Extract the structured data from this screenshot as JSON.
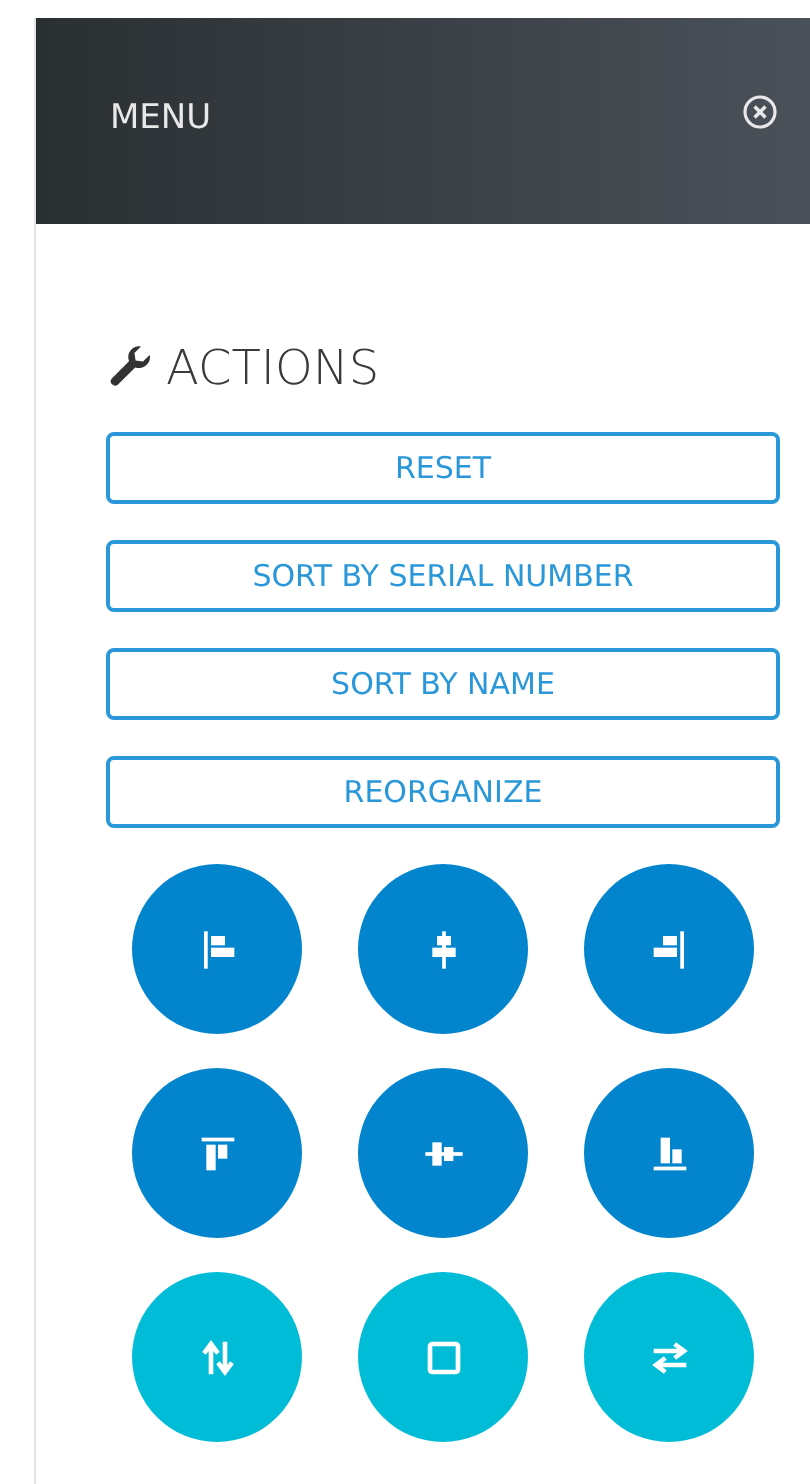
{
  "menu": {
    "title": "MENU"
  },
  "actions": {
    "heading": "ACTIONS",
    "buttons": [
      {
        "label": "RESET"
      },
      {
        "label": "SORT BY SERIAL NUMBER"
      },
      {
        "label": "SORT BY NAME"
      },
      {
        "label": "REORGANIZE"
      }
    ]
  },
  "tool_buttons": [
    {
      "color": "#0385cd"
    },
    {
      "color": "#0385cd"
    },
    {
      "color": "#0385cd"
    },
    {
      "color": "#0385cd"
    },
    {
      "color": "#0385cd"
    },
    {
      "color": "#0385cd"
    },
    {
      "color": "#00bcd7"
    },
    {
      "color": "#00bcd7"
    },
    {
      "color": "#00bcd7"
    }
  ]
}
